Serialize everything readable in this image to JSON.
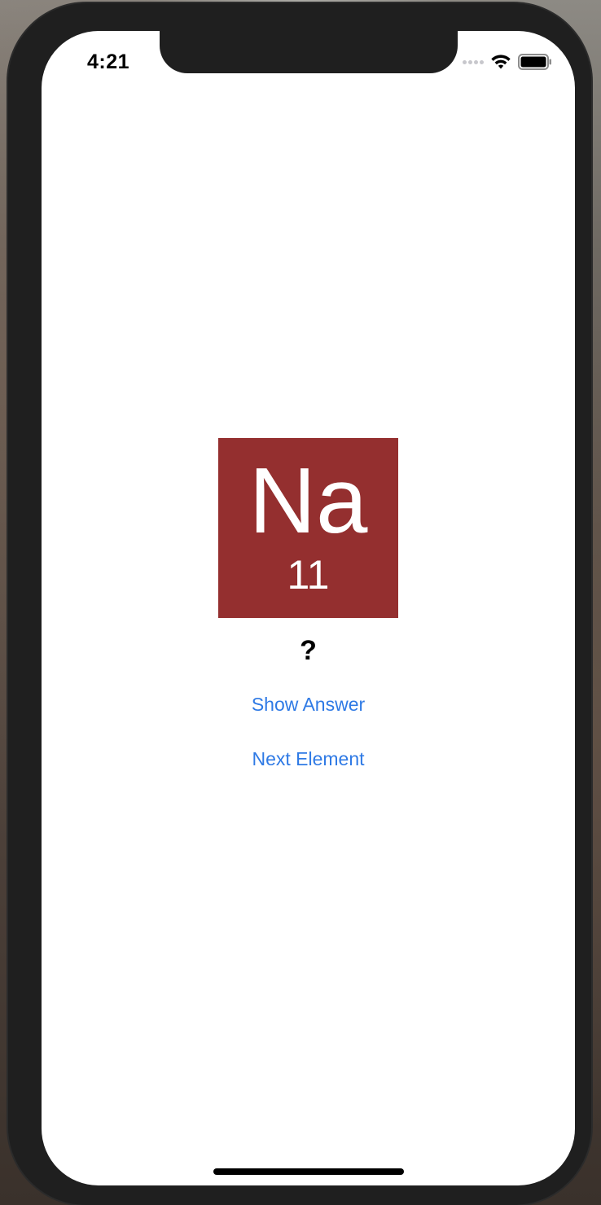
{
  "status_bar": {
    "time": "4:21",
    "signal_icon": "cellular-dots-icon",
    "wifi_icon": "wifi-icon",
    "battery_icon": "battery-icon"
  },
  "element_card": {
    "symbol": "Na",
    "atomic_number": "11",
    "tile_color": "#942f2f"
  },
  "answer": {
    "text": "?"
  },
  "buttons": {
    "show_answer": "Show Answer",
    "next_element": "Next Element",
    "accent_color": "#2f7ae5"
  }
}
